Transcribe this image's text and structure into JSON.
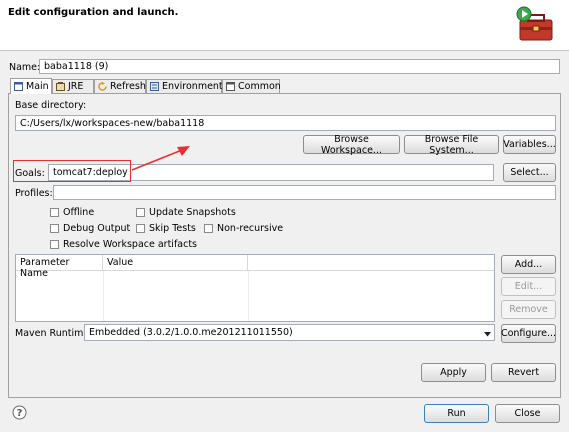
{
  "header": {
    "title": "Edit configuration and launch."
  },
  "name_label": "Name:",
  "name_value": "baba1118 (9)",
  "tabs": [
    {
      "label": "Main",
      "icon": "main-tab-icon"
    },
    {
      "label": "JRE",
      "icon": "jre-icon"
    },
    {
      "label": "Refresh",
      "icon": "refresh-icon"
    },
    {
      "label": "Environment",
      "icon": "environment-icon"
    },
    {
      "label": "Common",
      "icon": "common-icon"
    }
  ],
  "base_dir": {
    "label": "Base directory:",
    "value": "C:/Users/lx/workspaces-new/baba1118"
  },
  "browse_buttons": [
    "Browse Workspace...",
    "Browse File System...",
    "Variables..."
  ],
  "goals": {
    "label": "Goals:",
    "value": "tomcat7:deploy",
    "select_label": "Select..."
  },
  "profiles": {
    "label": "Profiles:",
    "value": ""
  },
  "options": [
    "Offline",
    "Update Snapshots",
    "Debug Output",
    "Skip Tests",
    "Non-recursive",
    "Resolve Workspace artifacts"
  ],
  "param_table": {
    "headers": [
      "Parameter Name",
      "Value"
    ]
  },
  "param_buttons": {
    "add": "Add...",
    "edit": "Edit...",
    "remove": "Remove"
  },
  "maven_runtime": {
    "label": "Maven Runtime:",
    "value": "Embedded (3.0.2/1.0.0.me201211011550)",
    "configure": "Configure..."
  },
  "apply_label": "Apply",
  "revert_label": "Revert",
  "run_label": "Run",
  "close_label": "Close",
  "help_icon": "help-icon",
  "colors": {
    "annotation": "#e8312f",
    "focus_border": "#3c7fb1"
  }
}
